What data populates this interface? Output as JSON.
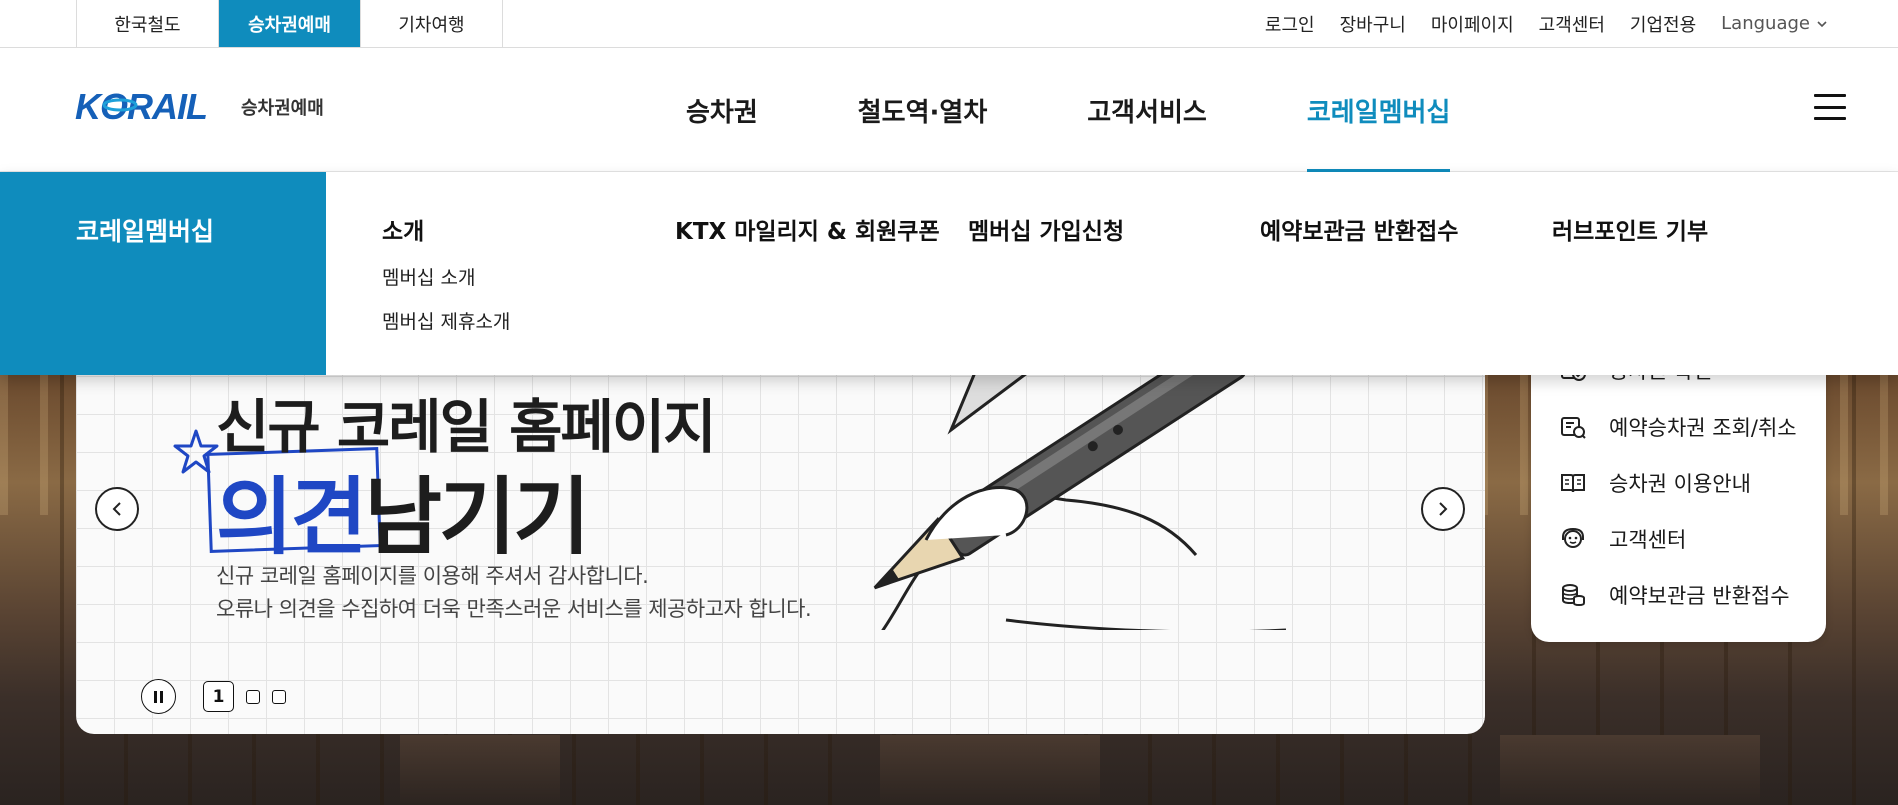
{
  "utility": {
    "tabs": [
      "한국철도",
      "승차권예매",
      "기차여행"
    ],
    "active_tab": "승차권예매",
    "links": [
      "로그인",
      "장바구니",
      "마이페이지",
      "고객센터",
      "기업전용"
    ],
    "language_label": "Language"
  },
  "header": {
    "logo_text": "KORAIL",
    "logo_sub": "승차권예매",
    "nav": [
      "승차권",
      "철도역·열차",
      "고객서비스",
      "코레일멤버십"
    ],
    "active_nav": "코레일멤버십"
  },
  "mega_menu": {
    "side_title": "코레일멤버십",
    "columns": [
      {
        "title": "소개",
        "items": [
          "멤버십 소개",
          "멤버십 제휴소개"
        ]
      },
      {
        "title": "KTX 마일리지 & 회원쿠폰",
        "items": []
      },
      {
        "title": "멤버십 가입신청",
        "items": []
      },
      {
        "title": "예약보관금 반환접수",
        "items": []
      },
      {
        "title": "러브포인트 기부",
        "items": []
      }
    ]
  },
  "banner": {
    "title_line1": "신규 코레일 홈페이지",
    "title_line2_highlight": "의견",
    "title_line2_rest": "남기기",
    "desc_line1": "신규 코레일 홈페이지를 이용해 주셔서 감사합니다.",
    "desc_line2": "오류나 의견을 수집하여 더욱 만족스러운 서비스를 제공하고자 합니다.",
    "current_slide": "1",
    "colors": {
      "highlight": "#1f47c4",
      "accent": "#0f8cbd"
    }
  },
  "quick_menu": {
    "items": [
      {
        "label": "승차권 확인",
        "icon": "ticket-check-icon"
      },
      {
        "label": "예약승차권 조회/취소",
        "icon": "ticket-search-icon"
      },
      {
        "label": "승차권 이용안내",
        "icon": "book-icon"
      },
      {
        "label": "고객센터",
        "icon": "headset-icon"
      },
      {
        "label": "예약보관금 반환접수",
        "icon": "coins-icon"
      }
    ]
  }
}
